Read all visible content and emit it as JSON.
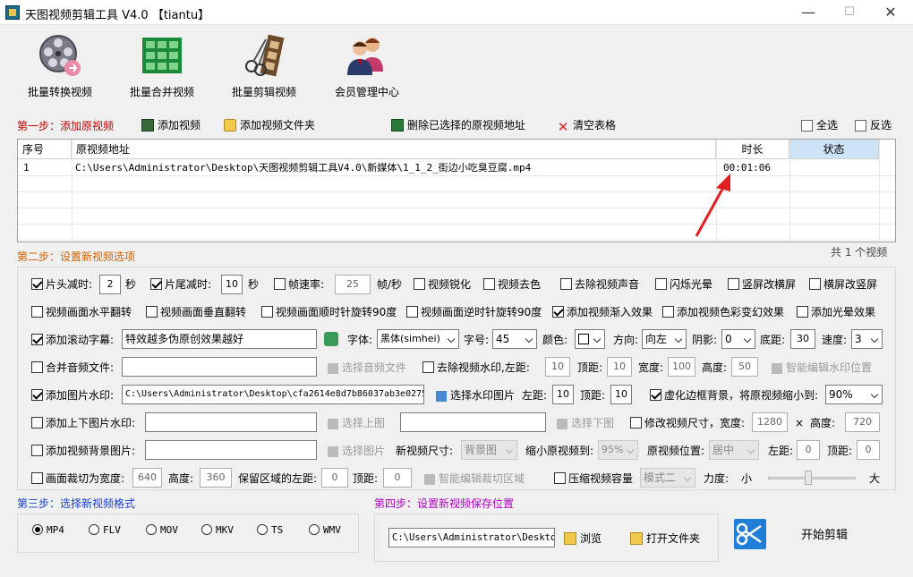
{
  "window": {
    "title": "天图视频剪辑工具 V4.0  【tiantu】",
    "minimize": "—",
    "maximize": "☐",
    "close": "✕"
  },
  "toolbar": [
    {
      "label": "批量转换视频",
      "icon": "film-reel-icon"
    },
    {
      "label": "批量合并视频",
      "icon": "merge-grid-icon"
    },
    {
      "label": "批量剪辑视频",
      "icon": "scissors-film-icon"
    },
    {
      "label": "会员管理中心",
      "icon": "users-icon"
    }
  ],
  "step1": {
    "title": "第一步：添加原视频",
    "add_video": "添加视频",
    "add_folder": "添加视频文件夹",
    "delete_selected": "删除已选择的原视频地址",
    "clear_table": "清空表格",
    "select_all": "全选",
    "invert_select": "反选"
  },
  "table": {
    "headers": [
      "序号",
      "原视频地址",
      "时长",
      "状态"
    ],
    "rows": [
      {
        "index": "1",
        "path": "C:\\Users\\Administrator\\Desktop\\天图视频剪辑工具V4.0\\新媒体\\1_1_2_街边小吃臭豆腐.mp4",
        "duration": "00:01:06",
        "status": ""
      }
    ],
    "count_text": "共 1 个视频"
  },
  "step2": {
    "title": "第二步：设置新视频选项",
    "row1": {
      "head_trim": "片头减时:",
      "head_value": "2",
      "sec1": "秒",
      "tail_trim": "片尾减时:",
      "tail_value": "10",
      "sec2": "秒",
      "framerate": "帧速率:",
      "framerate_value": "25",
      "fps_unit": "帧/秒",
      "sharpen": "视频锐化",
      "decolor": "视频去色",
      "remove_audio": "去除视频声音",
      "flash": "闪烁光晕",
      "v2h": "竖屏改横屏",
      "h2v": "横屏改竖屏"
    },
    "row2": {
      "hflip": "视频画面水平翻转",
      "vflip": "视频画面垂直翻转",
      "rot_cw": "视频画面顺时针旋转90度",
      "rot_ccw": "视频画面逆时针旋转90度",
      "fade_in": "添加视频渐入效果",
      "color_fx": "添加视频色彩变幻效果",
      "glow": "添加光晕效果"
    },
    "row3": {
      "scroll_text": "添加滚动字幕:",
      "scroll_value": "特效越多伪原创效果越好",
      "font_label": "字体:",
      "font_value": "黑体(simhei)",
      "size_label": "字号:",
      "size_value": "45",
      "color_label": "颜色:",
      "dir_label": "方向:",
      "dir_value": "向左",
      "shadow_label": "阴影:",
      "shadow_value": "0",
      "bottom_label": "底距:",
      "bottom_value": "30",
      "speed_label": "速度:",
      "speed_value": "3"
    },
    "row4": {
      "merge_audio": "合并音频文件:",
      "choose_audio": "选择音频文件",
      "remove_wm": "去除视频水印,左距:",
      "left_value": "10",
      "top_label": "顶距:",
      "top_value": "10",
      "width_label": "宽度:",
      "width_value": "100",
      "height_label": "高度:",
      "height_value": "50",
      "smart_wm": "智能编辑水印位置"
    },
    "row5": {
      "img_wm": "添加图片水印:",
      "img_wm_value": "C:\\Users\\Administrator\\Desktop\\cfa2614e8d7b86037ab3e0275",
      "choose_wm": "选择水印图片",
      "left_label": "左距:",
      "left_value": "10",
      "top_label": "顶距:",
      "top_value": "10",
      "blur_border": "虚化边框背景，将原视频缩小到:",
      "blur_value": "90%"
    },
    "row6": {
      "topbottom_img": "添加上下图片水印:",
      "upload_top": "选择上图",
      "upload_bottom": "选择下图",
      "resize": "修改视频尺寸，宽度:",
      "resize_w": "1280",
      "times": "×",
      "height_label": "高度:",
      "resize_h": "720"
    },
    "row7": {
      "bg_img": "添加视频背景图片:",
      "choose_img": "选择图片",
      "new_size_label": "新视频尺寸:",
      "new_size_value": "背景图",
      "shrink_label": "缩小原视频到:",
      "shrink_value": "95%",
      "pos_label": "原视频位置:",
      "pos_value": "居中",
      "left_label": "左距:",
      "left_value": "0",
      "top_label": "顶距:",
      "top_value": "0"
    },
    "row8": {
      "crop": "画面裁切为宽度:",
      "crop_w": "640",
      "height_label": "高度:",
      "crop_h": "360",
      "keep_left": "保留区域的左距:",
      "keep_left_value": "0",
      "top_label": "顶距:",
      "top_value": "0",
      "smart_crop": "智能编辑裁切区域",
      "compress": "压缩视频容量",
      "mode_value": "模式二",
      "strength": "力度:",
      "small": "小",
      "large": "大",
      "strength_level": 0.45
    }
  },
  "step3": {
    "title": "第三步：选择新视频格式",
    "formats": [
      "MP4",
      "FLV",
      "MOV",
      "MKV",
      "TS",
      "WMV"
    ],
    "selected": "MP4"
  },
  "step4": {
    "title": "第四步：设置新视频保存位置",
    "save_path": "C:\\Users\\Administrator\\Desktop\\",
    "browse": "浏览",
    "open_folder": "打开文件夹",
    "start": "开始剪辑"
  },
  "colors": {
    "accent_blue": "#1a3fd0",
    "step_red": "#c00000",
    "step_orange": "#d06000",
    "step_magenta": "#b000c0",
    "status_header": "#cfe3f6",
    "arrow_red": "#e02020"
  }
}
